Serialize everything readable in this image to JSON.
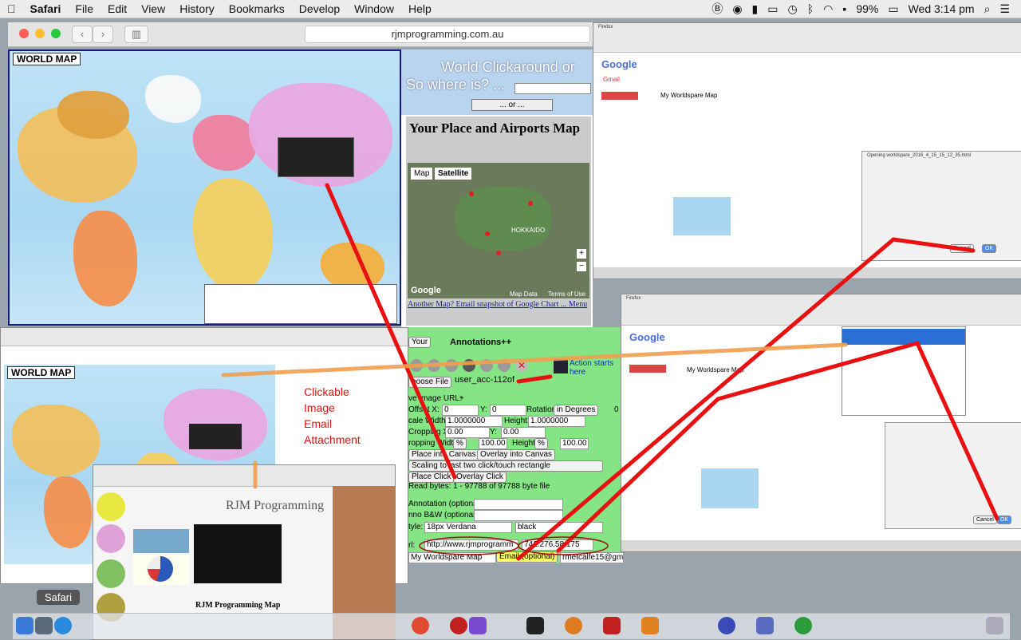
{
  "menubar": {
    "items": [
      "Safari",
      "File",
      "Edit",
      "View",
      "History",
      "Bookmarks",
      "Develop",
      "Window",
      "Help"
    ],
    "battery": "99%",
    "clock": "Wed 3:14 pm"
  },
  "safari": {
    "url": "rjmprogramming.com.au",
    "back": "‹",
    "forward": "›"
  },
  "left_map": {
    "tag": "WORLD MAP"
  },
  "right_page": {
    "header_line1": "World Clickaround or",
    "header_line2": "So where is? ...",
    "select_or": "... or ...",
    "place_title": "Your Place and Airports Map",
    "map_tab": "Map",
    "satellite_tab": "Satellite",
    "hokkaido": "HOKKAIDO",
    "google": "Google",
    "map_data": "Map Data",
    "terms": "Terms of Use",
    "links": "Another Map? Email snapshot of Google Chart ... Menu",
    "your_select": "Your",
    "annotations": "Annotations++",
    "choose_file": "hoose File",
    "file_name": "user_acc-112of",
    "action_starts": "Action starts here",
    "image_url_label": "ve Image URL:",
    "image_url_value": "+",
    "offset_x_label": "Offset X:",
    "offset_x_value": "0",
    "offset_y_label": "Y:",
    "offset_y_value": "0",
    "rotation_label": "Rotation",
    "rotation_unit": "in Degrees",
    "rotation_value": "0",
    "scale_width_label": "cale Width:",
    "scale_width_value": "1.0000000",
    "height_label": "Height:",
    "height_value": "1.0000000",
    "crop_x_label": "Cropping X:",
    "crop_x_value": "0.00",
    "crop_y_label": "Y:",
    "crop_y_value": "0.00",
    "crop_width_label": "ropping Width:",
    "crop_pct": "%",
    "crop_width_value": "100.00",
    "crop_height_label": "Height",
    "crop_height_value": "100.00",
    "place_canvas": "Place into Canvas",
    "overlay_canvas": "Overlay into Canvas",
    "scaling_select": "Scaling to last two click/touch rectangle",
    "place_click": "Place Click",
    "overlay_click": "Overlay Click",
    "read_bytes": "Read bytes: 1 - 97788 of 97788 byte file",
    "annotation_label": "Annotation (optional):",
    "anno_bw_label": "nno B&W (optional):",
    "style_label": "tyle:",
    "style_value": "18px Verdana",
    "color_value": "black",
    "url_label": "rl:",
    "url_value": "http://www.rjmprogramm",
    "coords_value": "741.276.58 175",
    "subject_value": "My Worldspare Map",
    "email_btn": "Email (optional)",
    "email_value": "rmetcalfe15@gmail.com"
  },
  "annotation": {
    "clickable": "Clickable",
    "image": "Image",
    "email": "Email",
    "attachment": "Attachment"
  },
  "top_shot": {
    "title": "Firefox",
    "gmail": "Gmail",
    "subject": "My Worldspare Map",
    "dialog_title": "Opening worldspare_2016_4_15_15_12_35.html",
    "ok": "OK",
    "cancel": "Cancel"
  },
  "mid_shot": {
    "title": "Firefox",
    "subject": "My Worldspare Map",
    "ok": "OK",
    "cancel": "Cancel"
  },
  "rjm": {
    "title": "RJM Programming",
    "subtitle": "RJM Programming Map"
  },
  "dock_label": "Safari"
}
